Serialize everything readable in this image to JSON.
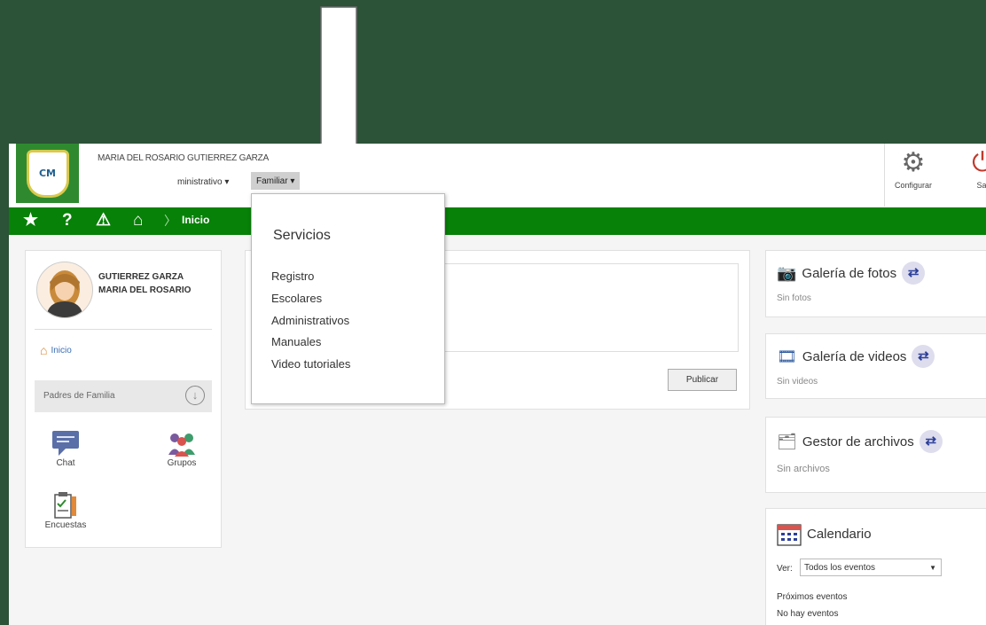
{
  "header": {
    "user_name": "MARIA DEL ROSARIO GUTIERREZ GARZA",
    "logo_text": "CM",
    "nav": {
      "admin_label": "ministrativo ▾",
      "familiar_label": "Familiar ▾"
    },
    "buttons": {
      "configurar": "Configurar",
      "salir": "Sal"
    }
  },
  "breadcrumb": {
    "current": "Inicio"
  },
  "profile": {
    "last_name": "GUTIERREZ GARZA",
    "first_name": "MARIA DEL ROSARIO",
    "inicio_link": "Inicio",
    "section_label": "Padres de Familia",
    "tools": [
      {
        "label": "Chat",
        "icon": "chat-icon"
      },
      {
        "label": "Grupos",
        "icon": "groups-icon"
      },
      {
        "label": "Encuestas",
        "icon": "survey-icon"
      }
    ]
  },
  "post": {
    "publish_label": "Publicar"
  },
  "dropdown": {
    "title": "Servicios",
    "items": [
      "Registro",
      "Escolares",
      "Administrativos",
      "Manuales",
      "Video tutoriales"
    ]
  },
  "widgets": {
    "photos": {
      "title": "Galería de fotos",
      "empty": "Sin fotos"
    },
    "videos": {
      "title": "Galería de videos",
      "empty": "Sin videos"
    },
    "files": {
      "title": "Gestor de archivos",
      "empty": "Sin archivos"
    },
    "calendar": {
      "title": "Calendario",
      "ver_label": "Ver:",
      "ver_value": "Todos los eventos",
      "upcoming_label": "Próximos eventos",
      "no_events": "No hay eventos"
    }
  },
  "colors": {
    "background": "#2c5238",
    "nav_bar": "#078107",
    "link": "#3b6fb6",
    "logout": "#c0392b"
  }
}
